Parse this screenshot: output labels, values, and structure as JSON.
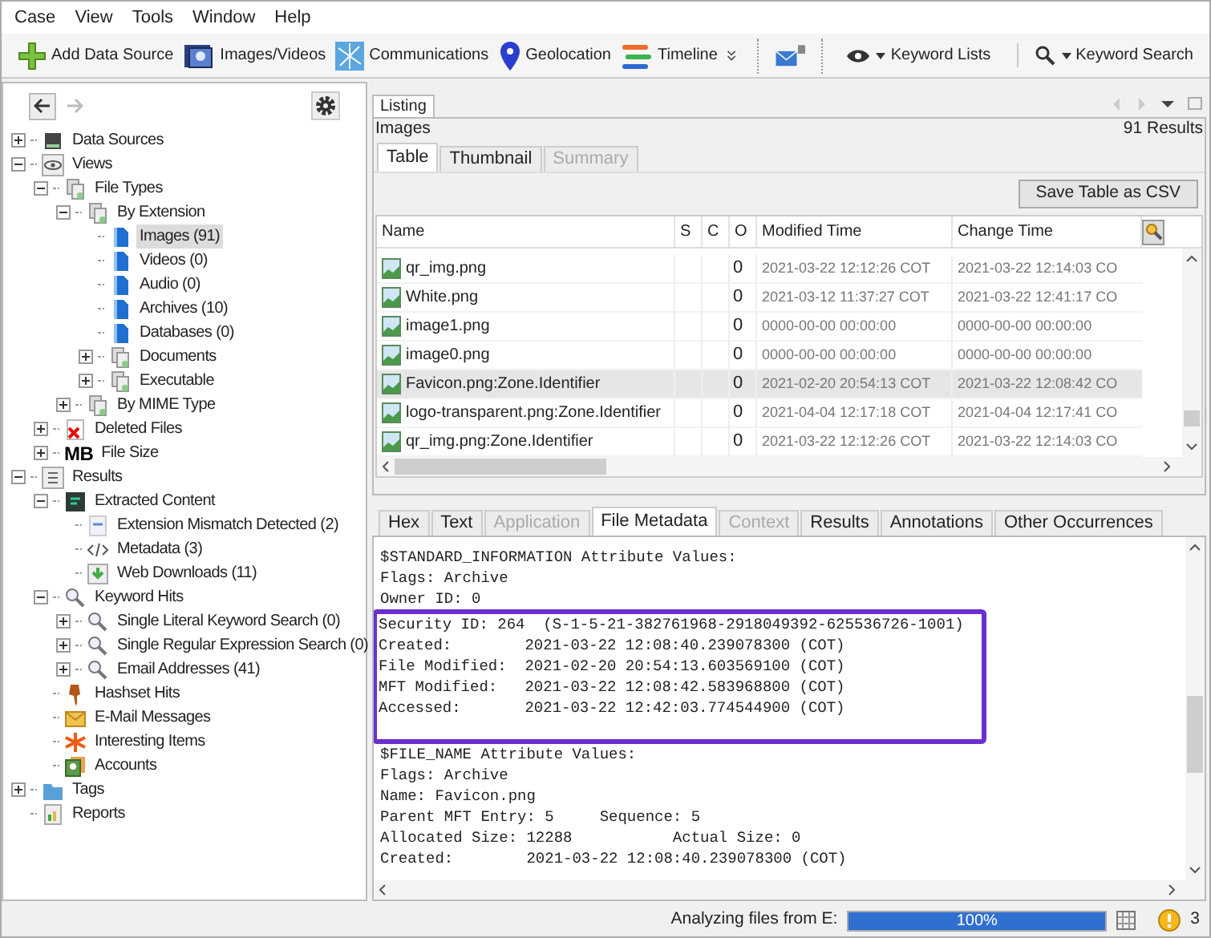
{
  "menu": [
    "Case",
    "View",
    "Tools",
    "Window",
    "Help"
  ],
  "toolbar": [
    {
      "kind": "add",
      "label": "Add Data Source"
    },
    {
      "kind": "images",
      "label": "Images/Videos"
    },
    {
      "kind": "comm",
      "label": "Communications"
    },
    {
      "kind": "geo",
      "label": "Geolocation"
    },
    {
      "kind": "timeline",
      "label": "Timeline"
    }
  ],
  "toolbar_right": [
    {
      "kind": "eye",
      "label": "Keyword Lists"
    },
    {
      "kind": "search",
      "label": "Keyword Search"
    }
  ],
  "tree": [
    {
      "kind": "drive",
      "label": "Data Sources",
      "expanded": false,
      "selected": false
    },
    {
      "kind": "views",
      "label": "Views",
      "expanded": true,
      "selected": false,
      "children": [
        {
          "kind": "group",
          "label": "File Types",
          "expanded": true,
          "selected": false,
          "children": [
            {
              "kind": "group",
              "label": "By Extension",
              "expanded": true,
              "selected": false,
              "children": [
                {
                  "kind": "file",
                  "label": "Images (91)",
                  "selected": true
                },
                {
                  "kind": "file",
                  "label": "Videos (0)",
                  "selected": false
                },
                {
                  "kind": "file",
                  "label": "Audio (0)",
                  "selected": false
                },
                {
                  "kind": "file",
                  "label": "Archives (10)",
                  "selected": false
                },
                {
                  "kind": "file",
                  "label": "Databases (0)",
                  "selected": false
                },
                {
                  "kind": "group",
                  "label": "Documents",
                  "expanded": false,
                  "selected": false
                },
                {
                  "kind": "group",
                  "label": "Executable",
                  "expanded": false,
                  "selected": false
                }
              ]
            },
            {
              "kind": "group",
              "label": "By MIME Type",
              "expanded": false,
              "selected": false
            }
          ]
        },
        {
          "kind": "deleted",
          "label": "Deleted Files",
          "expanded": false,
          "selected": false
        },
        {
          "kind": "size",
          "label": "File Size",
          "expanded": false,
          "selected": false
        }
      ]
    },
    {
      "kind": "results",
      "label": "Results",
      "expanded": true,
      "selected": false,
      "children": [
        {
          "kind": "extracted",
          "label": "Extracted Content",
          "expanded": true,
          "selected": false,
          "children": [
            {
              "kind": "mismatch",
              "label": "Extension Mismatch Detected (2)",
              "selected": false
            },
            {
              "kind": "code",
              "label": "Metadata (3)",
              "selected": false
            },
            {
              "kind": "download",
              "label": "Web Downloads (11)",
              "selected": false
            }
          ]
        },
        {
          "kind": "search",
          "label": "Keyword Hits",
          "expanded": true,
          "selected": false,
          "children": [
            {
              "kind": "search",
              "label": "Single Literal Keyword Search (0)",
              "expanded": false,
              "selected": false
            },
            {
              "kind": "search",
              "label": "Single Regular Expression Search (0)",
              "expanded": false,
              "selected": false
            },
            {
              "kind": "search",
              "label": "Email Addresses (41)",
              "expanded": false,
              "selected": false
            }
          ]
        },
        {
          "kind": "pin",
          "label": "Hashset Hits",
          "selected": false
        },
        {
          "kind": "mail",
          "label": "E-Mail Messages",
          "selected": false
        },
        {
          "kind": "star",
          "label": "Interesting Items",
          "selected": false
        },
        {
          "kind": "accounts",
          "label": "Accounts",
          "selected": false
        }
      ]
    },
    {
      "kind": "tags",
      "label": "Tags",
      "expanded": false,
      "selected": false
    },
    {
      "kind": "reports",
      "label": "Reports",
      "selected": false
    }
  ],
  "size_prefix": "MB",
  "listing": {
    "tab": "Listing",
    "title": "Images",
    "count": "91  Results",
    "view_tabs": [
      {
        "label": "Table",
        "selected": true,
        "disabled": false
      },
      {
        "label": "Thumbnail",
        "selected": false,
        "disabled": false
      },
      {
        "label": "Summary",
        "selected": false,
        "disabled": true
      }
    ],
    "save_button": "Save Table as CSV",
    "table": {
      "columns": [
        "Name",
        "S",
        "C",
        "O",
        "Modified Time",
        "Change Time"
      ],
      "rows": [
        {
          "name": "qr_img.png",
          "o": "0",
          "modified": "2021-03-22 12:12:26 COT",
          "change": "2021-03-22 12:14:03 CO",
          "selected": false
        },
        {
          "name": "White.png",
          "o": "0",
          "modified": "2021-03-12 11:37:27 COT",
          "change": "2021-03-22 12:41:17 CO",
          "selected": false
        },
        {
          "name": "image1.png",
          "o": "0",
          "modified": "0000-00-00 00:00:00",
          "change": "0000-00-00 00:00:00",
          "selected": false
        },
        {
          "name": "image0.png",
          "o": "0",
          "modified": "0000-00-00 00:00:00",
          "change": "0000-00-00 00:00:00",
          "selected": false
        },
        {
          "name": "Favicon.png:Zone.Identifier",
          "o": "0",
          "modified": "2021-02-20 20:54:13 COT",
          "change": "2021-03-22 12:08:42 CO",
          "selected": true
        },
        {
          "name": "logo-transparent.png:Zone.Identifier",
          "o": "0",
          "modified": "2021-04-04 12:17:18 COT",
          "change": "2021-04-04 12:17:41 CO",
          "selected": false
        },
        {
          "name": "qr_img.png:Zone.Identifier",
          "o": "0",
          "modified": "2021-03-22 12:12:26 COT",
          "change": "2021-03-22 12:14:03 CO",
          "selected": false
        }
      ]
    }
  },
  "content_tabs": [
    {
      "label": "Hex",
      "selected": false,
      "disabled": false
    },
    {
      "label": "Text",
      "selected": false,
      "disabled": false
    },
    {
      "label": "Application",
      "selected": false,
      "disabled": true
    },
    {
      "label": "File Metadata",
      "selected": true,
      "disabled": false
    },
    {
      "label": "Context",
      "selected": false,
      "disabled": true
    },
    {
      "label": "Results",
      "selected": false,
      "disabled": false
    },
    {
      "label": "Annotations",
      "selected": false,
      "disabled": false
    },
    {
      "label": "Other Occurrences",
      "selected": false,
      "disabled": false
    }
  ],
  "metadata": [
    {
      "highlighted": false,
      "lines": [
        "$STANDARD_INFORMATION Attribute Values:",
        "Flags: Archive",
        "Owner ID: 0"
      ]
    },
    {
      "highlighted": true,
      "lines": [
        "Security ID: 264  (S-1-5-21-382761968-2918049392-625536726-1001)",
        "Created:        2021-03-22 12:08:40.239078300 (COT)",
        "File Modified:  2021-02-20 20:54:13.603569100 (COT)",
        "MFT Modified:   2021-03-22 12:08:42.583968800 (COT)",
        "Accessed:       2021-03-22 12:42:03.774544900 (COT)"
      ]
    },
    {
      "highlighted": false,
      "lines": [
        "$FILE_NAME Attribute Values:",
        "Flags: Archive",
        "Name: Favicon.png",
        "Parent MFT Entry: 5     Sequence: 5",
        "Allocated Size: 12288           Actual Size: 0",
        "Created:        2021-03-22 12:08:40.239078300 (COT)"
      ]
    }
  ],
  "status": {
    "text": "Analyzing files from E:",
    "progress": {
      "level": 1,
      "label": "100%"
    },
    "notifications": "3"
  }
}
